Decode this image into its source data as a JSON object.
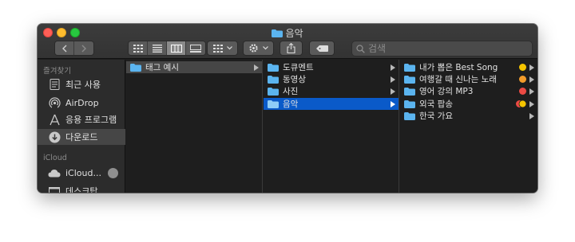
{
  "window": {
    "title": "음악"
  },
  "toolbar": {
    "back_icon": "chevron-left-icon",
    "forward_icon": "chevron-right-icon",
    "view_icons": [
      "icon-view-icon",
      "list-view-icon",
      "column-view-icon",
      "gallery-view-icon"
    ],
    "group_icon": "group-by-icon",
    "action_icon": "gear-icon",
    "share_icon": "share-icon",
    "tag_icon": "tag-icon",
    "search_placeholder": "검색"
  },
  "sidebar": {
    "favorites_header": "즐겨찾기",
    "favorites": [
      {
        "label": "최근 사용",
        "icon": "recents-icon"
      },
      {
        "label": "AirDrop",
        "icon": "airdrop-icon"
      },
      {
        "label": "응용 프로그램",
        "icon": "applications-icon"
      },
      {
        "label": "다운로드",
        "icon": "downloads-icon",
        "active": true
      }
    ],
    "icloud_header": "iCloud",
    "icloud": [
      {
        "label": "iCloud...",
        "icon": "icloud-icon"
      },
      {
        "label": "데스크탑",
        "icon": "desktop-icon"
      }
    ]
  },
  "columns": [
    {
      "items": [
        {
          "label": "태그 예시",
          "selected": "grey"
        }
      ]
    },
    {
      "items": [
        {
          "label": "도큐멘트"
        },
        {
          "label": "동영상"
        },
        {
          "label": "사진"
        },
        {
          "label": "음악",
          "selected": "blue"
        }
      ]
    },
    {
      "items": [
        {
          "label": "내가 뽑은 Best Song",
          "tags": [
            "#f5c400"
          ]
        },
        {
          "label": "여행갈 때 신나는 노래",
          "tags": [
            "#f39c2b"
          ]
        },
        {
          "label": "영어 강의 MP3",
          "tags": [
            "#ec4a44"
          ]
        },
        {
          "label": "외국 팝송",
          "tags": [
            "#ec4a44",
            "#f5c400"
          ]
        },
        {
          "label": "한국 가요",
          "tags": []
        }
      ]
    }
  ],
  "colors": {
    "accent": "#0a5ac9",
    "folder": "#5bb4ef"
  }
}
